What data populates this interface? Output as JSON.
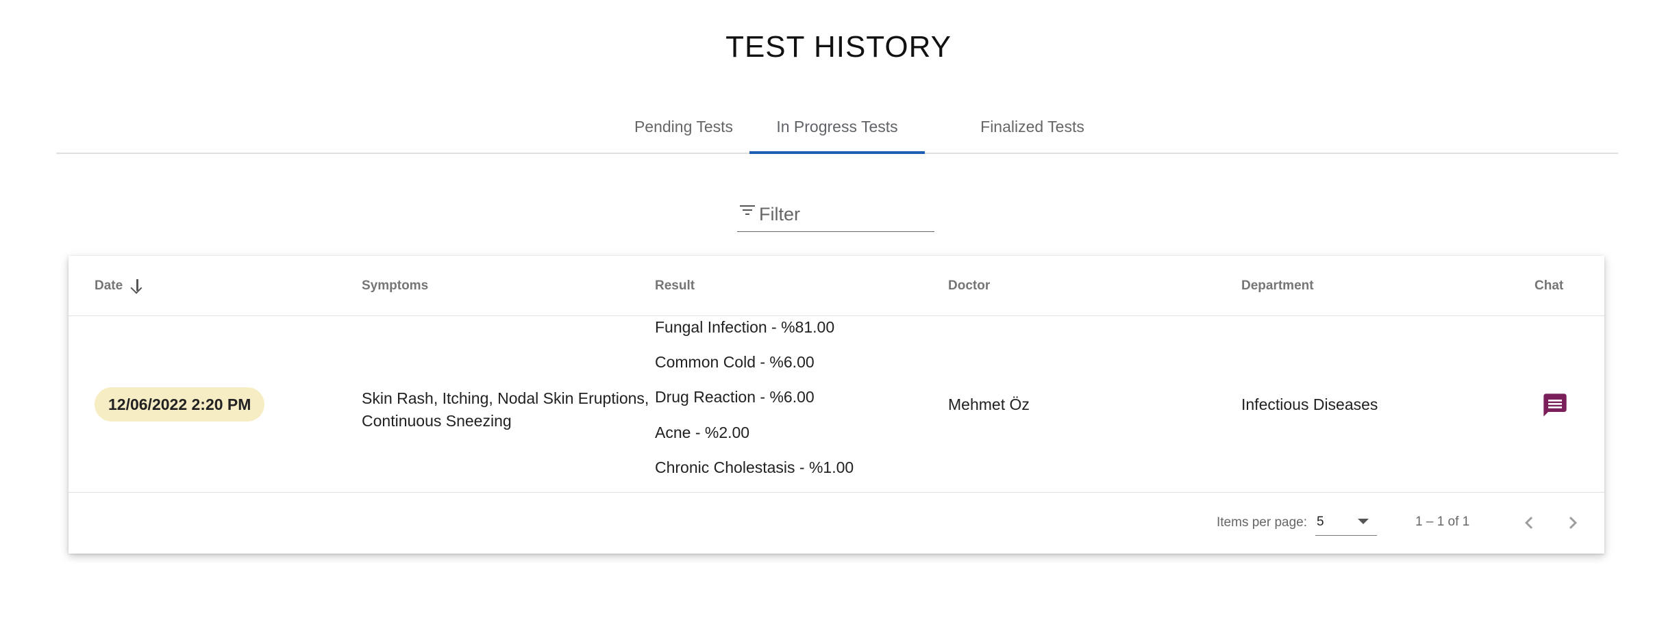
{
  "page": {
    "title": "TEST HISTORY"
  },
  "tabs": [
    {
      "label": "Pending Tests",
      "active": false
    },
    {
      "label": "In Progress Tests",
      "active": true
    },
    {
      "label": "Finalized Tests",
      "active": false
    }
  ],
  "filter": {
    "placeholder": "Filter",
    "value": "",
    "icon": "filter-list-icon"
  },
  "table": {
    "columns": {
      "date": "Date",
      "symptoms": "Symptoms",
      "result": "Result",
      "doctor": "Doctor",
      "department": "Department",
      "chat": "Chat"
    },
    "sort": {
      "column": "Date",
      "direction": "descending",
      "icon": "arrow-downward-icon"
    },
    "rows": [
      {
        "date": "12/06/2022 2:20 PM",
        "symptoms": "Skin Rash, Itching, Nodal Skin Eruptions, Continuous Sneezing",
        "results": [
          "Fungal Infection - %81.00",
          "Common Cold - %6.00",
          "Drug Reaction - %6.00",
          "Acne - %2.00",
          "Chronic Cholestasis - %1.00"
        ],
        "doctor": "Mehmet Öz",
        "department": "Infectious Diseases",
        "chat_icon": "chat-icon"
      }
    ]
  },
  "paginator": {
    "items_per_page_label": "Items per page:",
    "items_per_page": "5",
    "range": "1 – 1 of 1",
    "prev_icon": "chevron-left-icon",
    "next_icon": "chevron-right-icon"
  },
  "colors": {
    "accent": "#1e5fb3",
    "date_chip_bg": "#f6edc4",
    "chat_icon": "#7b1f5a"
  }
}
